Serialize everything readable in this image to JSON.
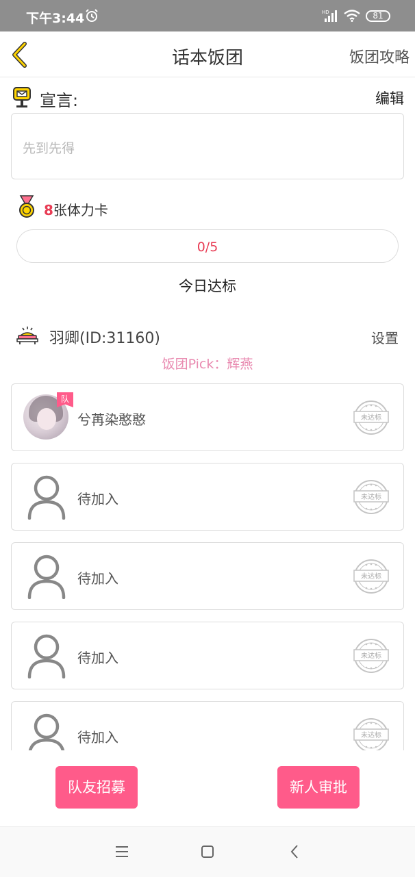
{
  "status_bar": {
    "time": "下午3:44",
    "battery": "81",
    "alarm_icon": "alarm-clock-icon",
    "signal_icon": "hd-signal-icon",
    "wifi_icon": "wifi-icon"
  },
  "nav": {
    "back_icon": "chevron-left-icon",
    "title": "话本饭团",
    "guide_label": "饭团攻略"
  },
  "declaration": {
    "icon": "mailbox-icon",
    "label": "宣言:",
    "edit_label": "编辑",
    "text": "先到先得"
  },
  "stamina": {
    "icon": "medal-icon",
    "count": "8",
    "suffix": "张体力卡"
  },
  "progress": {
    "current": 0,
    "total": 5,
    "text": "0/5",
    "label": "今日达标"
  },
  "team": {
    "leader_icon": "throne-icon",
    "leader_name": "羽卿(ID:31160)",
    "settings_label": "设置",
    "pick_text": "饭团Pick：辉燕"
  },
  "members": [
    {
      "name": "兮苒染憨憨",
      "avatar": "photo",
      "tag": "队",
      "stamp": "未达标"
    },
    {
      "name": "待加入",
      "avatar": "person-icon",
      "tag": "",
      "stamp": "未达标"
    },
    {
      "name": "待加入",
      "avatar": "person-icon",
      "tag": "",
      "stamp": "未达标"
    },
    {
      "name": "待加入",
      "avatar": "person-icon",
      "tag": "",
      "stamp": "未达标"
    },
    {
      "name": "待加入",
      "avatar": "person-icon",
      "tag": "",
      "stamp": "未达标"
    }
  ],
  "buttons": {
    "recruit": "队友招募",
    "approve": "新人审批"
  },
  "system_nav": {
    "menu_icon": "menu-icon",
    "home_icon": "home-square-icon",
    "back_icon": "back-triangle-icon"
  },
  "colors": {
    "accent_pink": "#ff5b8a",
    "count_red": "#e83c54",
    "pick_pink": "#e98ab0",
    "status_bar": "#8e8e8e"
  }
}
